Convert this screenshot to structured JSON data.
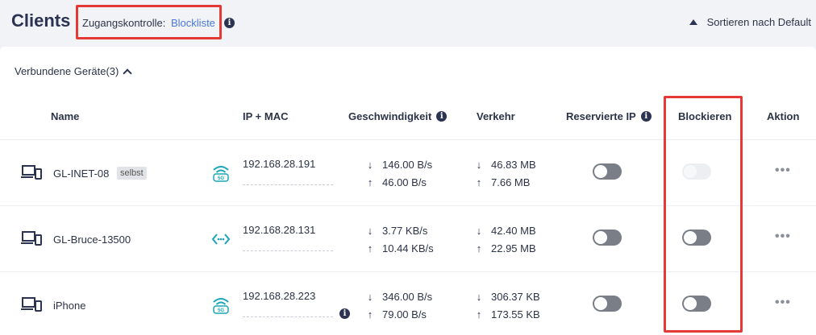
{
  "header": {
    "title": "Clients",
    "access_label": "Zugangskontrolle:",
    "access_value": "Blockliste",
    "sort_label": "Sortieren nach Default"
  },
  "section": {
    "title": "Verbundene Geräte(3)"
  },
  "columns": {
    "name": "Name",
    "ip_mac": "IP + MAC",
    "speed": "Geschwindigkeit",
    "traffic": "Verkehr",
    "reserved_ip": "Reservierte IP",
    "block": "Blockieren",
    "action": "Aktion"
  },
  "rows": [
    {
      "name": "GL-INET-08",
      "badge": "selbst",
      "connection_icon": "wifi-5g-icon",
      "ip": "192.168.28.191",
      "speed_down": "146.00 B/s",
      "speed_up": "46.00 B/s",
      "traffic_down": "46.83 MB",
      "traffic_up": "7.66 MB",
      "reserved_ip": false,
      "blocked": false,
      "block_disabled": true
    },
    {
      "name": "GL-Bruce-13500",
      "badge": "",
      "connection_icon": "ethernet-icon",
      "ip": "192.168.28.131",
      "speed_down": "3.77 KB/s",
      "speed_up": "10.44 KB/s",
      "traffic_down": "42.40 MB",
      "traffic_up": "22.95 MB",
      "reserved_ip": false,
      "blocked": false,
      "block_disabled": false
    },
    {
      "name": "iPhone",
      "badge": "",
      "connection_icon": "wifi-5g-icon",
      "ip": "192.168.28.223",
      "speed_down": "346.00 B/s",
      "speed_up": "79.00 B/s",
      "traffic_down": "306.37 KB",
      "traffic_up": "173.55 KB",
      "reserved_ip": false,
      "blocked": false,
      "block_disabled": false
    }
  ],
  "icons": {
    "info": "i",
    "down_arrow": "↓",
    "up_arrow": "↑",
    "more": "•••",
    "wifi_band": "5G"
  },
  "colors": {
    "accent": "#4a78d6",
    "wifi_icon": "#1aa6b7",
    "highlight_box": "#e53935"
  }
}
